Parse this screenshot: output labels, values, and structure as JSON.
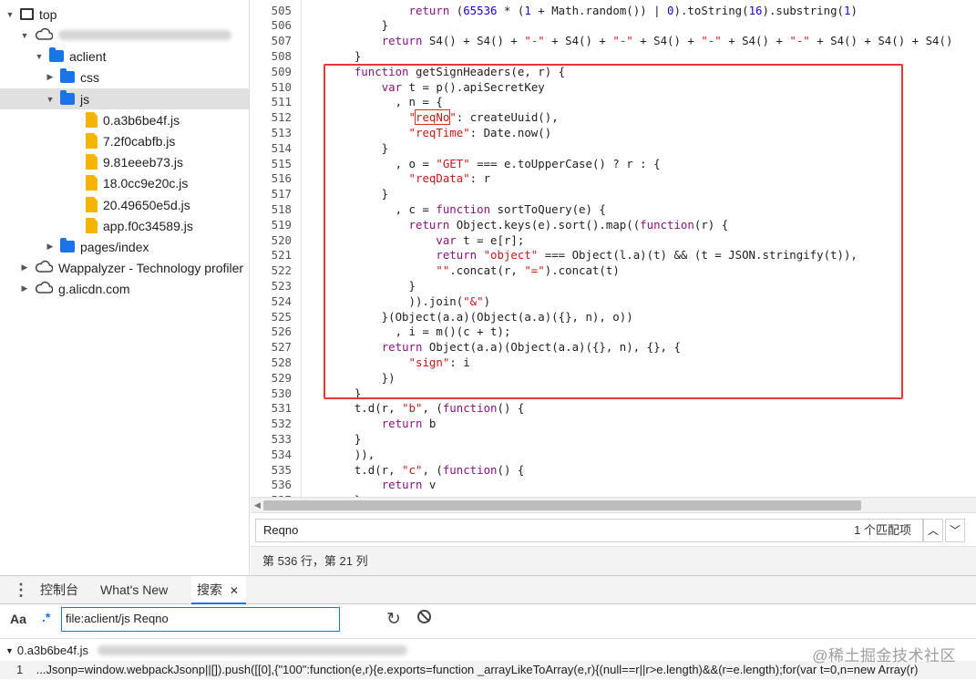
{
  "tree": {
    "items": [
      {
        "label": "top",
        "arrow": "▼",
        "icon": "frame-icon",
        "indent": 0,
        "blurred": false
      },
      {
        "label": "",
        "arrow": "▼",
        "icon": "cloud-icon",
        "indent": 1,
        "blurred": true
      },
      {
        "label": "aclient",
        "arrow": "▼",
        "icon": "folder-icon",
        "indent": 2,
        "blurred": false
      },
      {
        "label": "css",
        "arrow": "▶",
        "icon": "folder-icon",
        "indent": 3,
        "blurred": false
      },
      {
        "label": "js",
        "arrow": "▼",
        "icon": "folder-icon",
        "indent": 3,
        "blurred": false,
        "selected": true
      },
      {
        "label": "0.a3b6be4f.js",
        "arrow": "",
        "icon": "file-icon",
        "indent": 4,
        "blurred": false
      },
      {
        "label": "7.2f0cabfb.js",
        "arrow": "",
        "icon": "file-icon",
        "indent": 4,
        "blurred": false
      },
      {
        "label": "9.81eeeb73.js",
        "arrow": "",
        "icon": "file-icon",
        "indent": 4,
        "blurred": false
      },
      {
        "label": "18.0cc9e20c.js",
        "arrow": "",
        "icon": "file-icon",
        "indent": 4,
        "blurred": false
      },
      {
        "label": "20.49650e5d.js",
        "arrow": "",
        "icon": "file-icon",
        "indent": 4,
        "blurred": false
      },
      {
        "label": "app.f0c34589.js",
        "arrow": "",
        "icon": "file-icon",
        "indent": 4,
        "blurred": false
      },
      {
        "label": "pages/index",
        "arrow": "▶",
        "icon": "folder-icon",
        "indent": 3,
        "blurred": false
      },
      {
        "label": "Wappalyzer - Technology profiler",
        "arrow": "▶",
        "icon": "cloud-icon",
        "indent": 1,
        "blurred": false
      },
      {
        "label": "g.alicdn.com",
        "arrow": "▶",
        "icon": "cloud-icon",
        "indent": 1,
        "blurred": false
      }
    ]
  },
  "editor": {
    "lines": [
      {
        "num": "505",
        "tokens": [
          [
            "            ",
            ""
          ],
          [
            "return",
            "k"
          ],
          [
            " (",
            ""
          ],
          [
            "65536",
            "n"
          ],
          [
            " * (",
            ""
          ],
          [
            "1",
            "n"
          ],
          [
            " + Math.random()) | ",
            ""
          ],
          [
            "0",
            "n"
          ],
          [
            ").toString(",
            ""
          ],
          [
            "16",
            "n"
          ],
          [
            ").substring(",
            ""
          ],
          [
            "1",
            "n"
          ],
          [
            ")",
            ""
          ]
        ]
      },
      {
        "num": "506",
        "tokens": [
          [
            "        }",
            ""
          ]
        ]
      },
      {
        "num": "507",
        "tokens": [
          [
            "        ",
            ""
          ],
          [
            "return",
            "k"
          ],
          [
            " S4() + S4() + ",
            ""
          ],
          [
            "\"-\"",
            "s"
          ],
          [
            " + S4() + ",
            ""
          ],
          [
            "\"-\"",
            "s"
          ],
          [
            " + S4() + ",
            ""
          ],
          [
            "\"-\"",
            "s"
          ],
          [
            " + S4() + ",
            ""
          ],
          [
            "\"-\"",
            "s"
          ],
          [
            " + S4() + S4() + S4()",
            ""
          ]
        ]
      },
      {
        "num": "508",
        "tokens": [
          [
            "    }",
            ""
          ]
        ]
      },
      {
        "num": "509",
        "tokens": [
          [
            "    ",
            ""
          ],
          [
            "function",
            "k"
          ],
          [
            " getSignHeaders(e, r) {",
            ""
          ]
        ]
      },
      {
        "num": "510",
        "tokens": [
          [
            "        ",
            ""
          ],
          [
            "var",
            "k"
          ],
          [
            " t = p().apiSecretKey",
            ""
          ]
        ]
      },
      {
        "num": "511",
        "tokens": [
          [
            "          , n = {",
            ""
          ]
        ]
      },
      {
        "num": "512",
        "tokens": [
          [
            "            ",
            ""
          ],
          [
            "\"",
            "s"
          ],
          [
            "reqNo",
            "s mk"
          ],
          [
            "\"",
            "s"
          ],
          [
            ": createUuid(),",
            ""
          ]
        ]
      },
      {
        "num": "513",
        "tokens": [
          [
            "            ",
            ""
          ],
          [
            "\"reqTime\"",
            "s"
          ],
          [
            ": Date.now()",
            ""
          ]
        ]
      },
      {
        "num": "514",
        "tokens": [
          [
            "        }",
            ""
          ]
        ]
      },
      {
        "num": "515",
        "tokens": [
          [
            "          , o = ",
            ""
          ],
          [
            "\"GET\"",
            "s"
          ],
          [
            " === e.toUpperCase() ? r : {",
            ""
          ]
        ]
      },
      {
        "num": "516",
        "tokens": [
          [
            "            ",
            ""
          ],
          [
            "\"reqData\"",
            "s"
          ],
          [
            ": r",
            ""
          ]
        ]
      },
      {
        "num": "517",
        "tokens": [
          [
            "        }",
            ""
          ]
        ]
      },
      {
        "num": "518",
        "tokens": [
          [
            "          , c = ",
            ""
          ],
          [
            "function",
            "k"
          ],
          [
            " sortToQuery(e) {",
            ""
          ]
        ]
      },
      {
        "num": "519",
        "tokens": [
          [
            "            ",
            ""
          ],
          [
            "return",
            "k"
          ],
          [
            " Object.keys(e).sort().map((",
            ""
          ],
          [
            "function",
            "k"
          ],
          [
            "(r) {",
            ""
          ]
        ]
      },
      {
        "num": "520",
        "tokens": [
          [
            "                ",
            ""
          ],
          [
            "var",
            "k"
          ],
          [
            " t = e[r];",
            ""
          ]
        ]
      },
      {
        "num": "521",
        "tokens": [
          [
            "                ",
            ""
          ],
          [
            "return",
            "k"
          ],
          [
            " ",
            ""
          ],
          [
            "\"object\"",
            "s"
          ],
          [
            " === Object(l.a)(t) && (t = JSON.stringify(t)),",
            ""
          ]
        ]
      },
      {
        "num": "522",
        "tokens": [
          [
            "                ",
            ""
          ],
          [
            "\"\"",
            "s"
          ],
          [
            ".concat(r, ",
            ""
          ],
          [
            "\"=\"",
            "s"
          ],
          [
            ").concat(t)",
            ""
          ]
        ]
      },
      {
        "num": "523",
        "tokens": [
          [
            "            }",
            ""
          ]
        ]
      },
      {
        "num": "524",
        "tokens": [
          [
            "            )).join(",
            ""
          ],
          [
            "\"&\"",
            "s"
          ],
          [
            ")",
            ""
          ]
        ]
      },
      {
        "num": "525",
        "tokens": [
          [
            "        }(Object(a.a)(Object(a.a)({}, n), o))",
            ""
          ]
        ]
      },
      {
        "num": "526",
        "tokens": [
          [
            "          , i = m()(c + t);",
            ""
          ]
        ]
      },
      {
        "num": "527",
        "tokens": [
          [
            "        ",
            ""
          ],
          [
            "return",
            "k"
          ],
          [
            " Object(a.a)(Object(a.a)({}, n), {}, {",
            ""
          ]
        ]
      },
      {
        "num": "528",
        "tokens": [
          [
            "            ",
            ""
          ],
          [
            "\"sign\"",
            "s"
          ],
          [
            ": i",
            ""
          ]
        ]
      },
      {
        "num": "529",
        "tokens": [
          [
            "        })",
            ""
          ]
        ]
      },
      {
        "num": "530",
        "tokens": [
          [
            "    }",
            ""
          ]
        ]
      },
      {
        "num": "531",
        "tokens": [
          [
            "    t.d(r, ",
            ""
          ],
          [
            "\"b\"",
            "s"
          ],
          [
            ", (",
            ""
          ],
          [
            "function",
            "k"
          ],
          [
            "() {",
            ""
          ]
        ]
      },
      {
        "num": "532",
        "tokens": [
          [
            "        ",
            ""
          ],
          [
            "return",
            "k"
          ],
          [
            " b",
            ""
          ]
        ]
      },
      {
        "num": "533",
        "tokens": [
          [
            "    }",
            ""
          ]
        ]
      },
      {
        "num": "534",
        "tokens": [
          [
            "    )),",
            ""
          ]
        ]
      },
      {
        "num": "535",
        "tokens": [
          [
            "    t.d(r, ",
            ""
          ],
          [
            "\"c\"",
            "s"
          ],
          [
            ", (",
            ""
          ],
          [
            "function",
            "k"
          ],
          [
            "() {",
            ""
          ]
        ]
      },
      {
        "num": "536",
        "tokens": [
          [
            "        ",
            ""
          ],
          [
            "return",
            "k"
          ],
          [
            " v",
            ""
          ]
        ]
      },
      {
        "num": "537",
        "tokens": [
          [
            "    }",
            ""
          ]
        ]
      }
    ]
  },
  "find": {
    "query": "Reqno",
    "match_count": "1 个匹配项",
    "prev_icon": "chevron-up-icon",
    "next_icon": "chevron-down-icon"
  },
  "status": {
    "position": "第 536 行，第 21 列"
  },
  "drawer": {
    "menu_icon": "kebab-menu-icon",
    "tabs": [
      {
        "label": "控制台",
        "active": false
      },
      {
        "label": "What's New",
        "active": false
      },
      {
        "label": "搜索",
        "active": true,
        "closable": true
      }
    ],
    "close_glyph": "✕"
  },
  "search": {
    "match_case_label": "Aa",
    "regex_label": ".*",
    "query": "file:aclient/js Reqno",
    "refresh_icon": "refresh-icon",
    "clear_icon": "clear-icon"
  },
  "results": {
    "file": "0.a3b6be4f.js",
    "line_num": "1",
    "line_text": "...Jsonp=window.webpackJsonp||[]).push([[0],{\"100\":function(e,r){e.exports=function _arrayLikeToArray(e,r){(null==r||r>e.length)&&(r=e.length);for(var t=0,n=new Array(r)",
    "watermark": "@稀土掘金技术社区"
  },
  "colors": {
    "accent": "#1a73e8",
    "highlight_box": "#e53935",
    "keyword": "#881280",
    "string": "#c41a16",
    "number": "#1c00cf",
    "file_icon": "#f4b400"
  }
}
